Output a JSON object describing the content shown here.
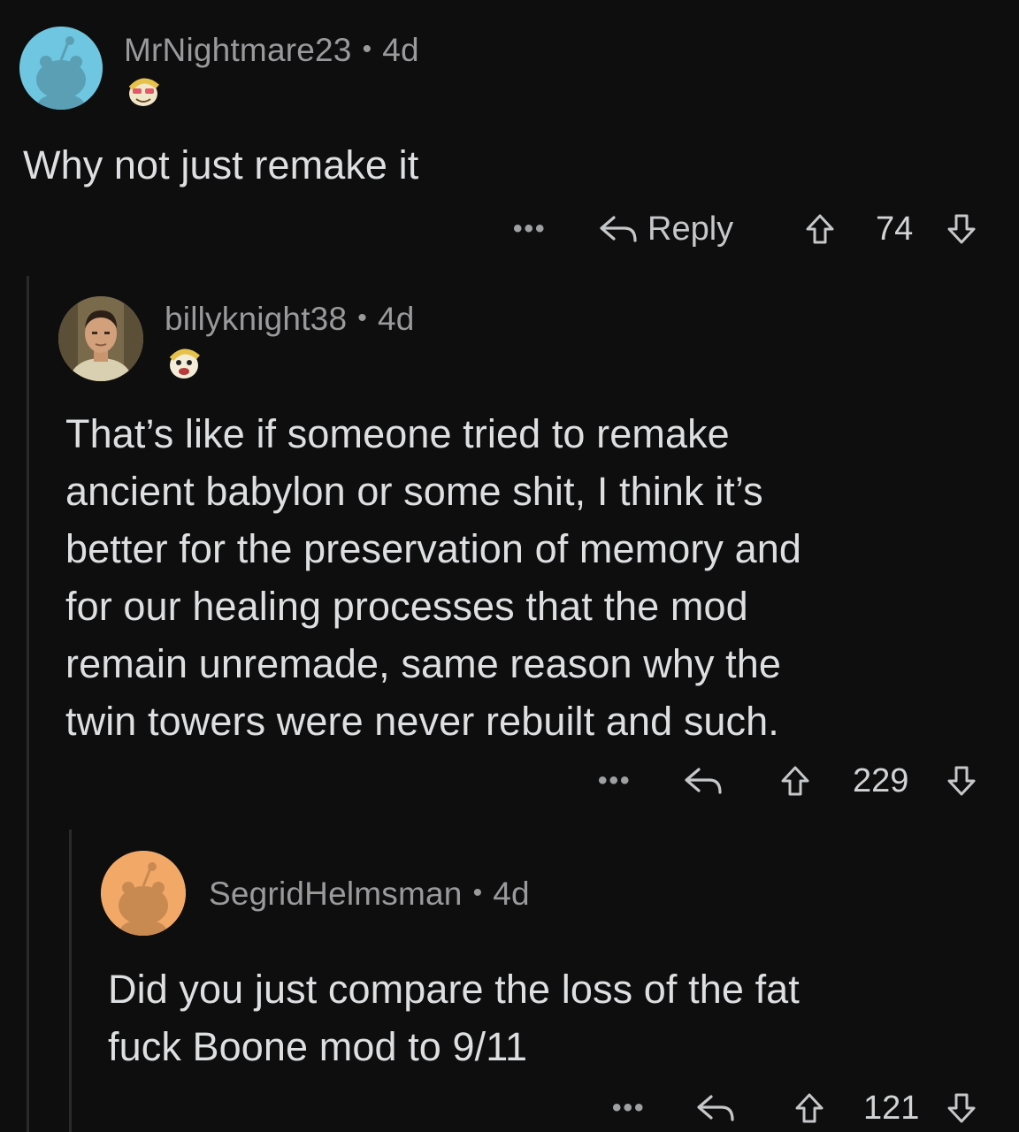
{
  "comments": [
    {
      "username": "MrNightmare23",
      "age": "4d",
      "body": "Why not just remake it",
      "reply_label": "Reply",
      "score": "74",
      "more_label": "•••"
    },
    {
      "username": "billyknight38",
      "age": "4d",
      "body_lines": [
        "That’s like if someone tried to remake",
        "ancient babylon or some shit, I think it’s",
        "better for the preservation of memory and",
        "for our healing processes that the mod",
        "remain unremade, same reason why the",
        "twin towers were never rebuilt and such."
      ],
      "score": "229",
      "more_label": "•••"
    },
    {
      "username": "SegridHelmsman",
      "age": "4d",
      "body_lines": [
        "Did you just compare the loss of the fat",
        "fuck Boone mod to 9/11"
      ],
      "score": "121",
      "more_label": "•••"
    }
  ],
  "separator": "•",
  "colors": {
    "background": "#0e0e0f",
    "avatar_blue": "#6ec6e0",
    "avatar_orange": "#f2a867",
    "thread_line": "#2a2a2c"
  },
  "icons": [
    "reply-icon",
    "upvote-icon",
    "downvote-icon",
    "snoo-avatar-icon",
    "vault-boy-flair-icon"
  ]
}
